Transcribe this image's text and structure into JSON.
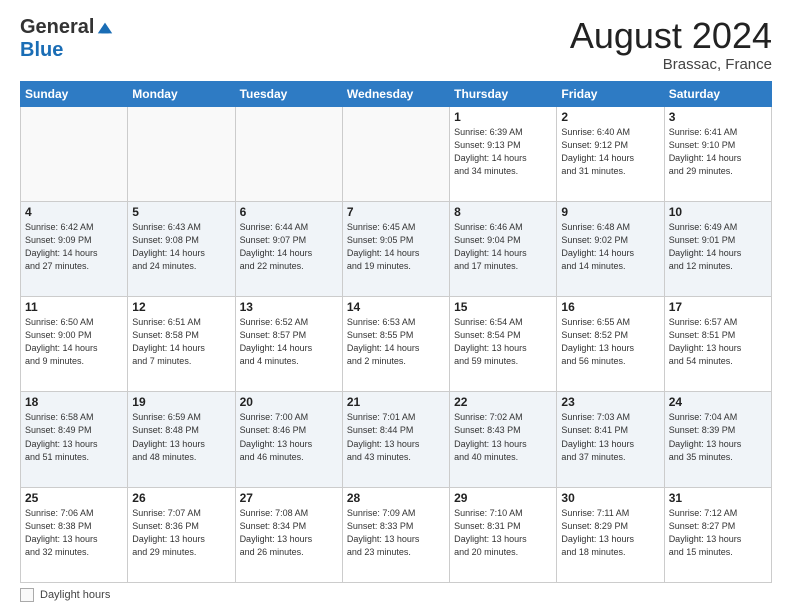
{
  "logo": {
    "general": "General",
    "blue": "Blue"
  },
  "header": {
    "month_year": "August 2024",
    "location": "Brassac, France"
  },
  "days_of_week": [
    "Sunday",
    "Monday",
    "Tuesday",
    "Wednesday",
    "Thursday",
    "Friday",
    "Saturday"
  ],
  "weeks": [
    [
      {
        "day": "",
        "info": ""
      },
      {
        "day": "",
        "info": ""
      },
      {
        "day": "",
        "info": ""
      },
      {
        "day": "",
        "info": ""
      },
      {
        "day": "1",
        "info": "Sunrise: 6:39 AM\nSunset: 9:13 PM\nDaylight: 14 hours\nand 34 minutes."
      },
      {
        "day": "2",
        "info": "Sunrise: 6:40 AM\nSunset: 9:12 PM\nDaylight: 14 hours\nand 31 minutes."
      },
      {
        "day": "3",
        "info": "Sunrise: 6:41 AM\nSunset: 9:10 PM\nDaylight: 14 hours\nand 29 minutes."
      }
    ],
    [
      {
        "day": "4",
        "info": "Sunrise: 6:42 AM\nSunset: 9:09 PM\nDaylight: 14 hours\nand 27 minutes."
      },
      {
        "day": "5",
        "info": "Sunrise: 6:43 AM\nSunset: 9:08 PM\nDaylight: 14 hours\nand 24 minutes."
      },
      {
        "day": "6",
        "info": "Sunrise: 6:44 AM\nSunset: 9:07 PM\nDaylight: 14 hours\nand 22 minutes."
      },
      {
        "day": "7",
        "info": "Sunrise: 6:45 AM\nSunset: 9:05 PM\nDaylight: 14 hours\nand 19 minutes."
      },
      {
        "day": "8",
        "info": "Sunrise: 6:46 AM\nSunset: 9:04 PM\nDaylight: 14 hours\nand 17 minutes."
      },
      {
        "day": "9",
        "info": "Sunrise: 6:48 AM\nSunset: 9:02 PM\nDaylight: 14 hours\nand 14 minutes."
      },
      {
        "day": "10",
        "info": "Sunrise: 6:49 AM\nSunset: 9:01 PM\nDaylight: 14 hours\nand 12 minutes."
      }
    ],
    [
      {
        "day": "11",
        "info": "Sunrise: 6:50 AM\nSunset: 9:00 PM\nDaylight: 14 hours\nand 9 minutes."
      },
      {
        "day": "12",
        "info": "Sunrise: 6:51 AM\nSunset: 8:58 PM\nDaylight: 14 hours\nand 7 minutes."
      },
      {
        "day": "13",
        "info": "Sunrise: 6:52 AM\nSunset: 8:57 PM\nDaylight: 14 hours\nand 4 minutes."
      },
      {
        "day": "14",
        "info": "Sunrise: 6:53 AM\nSunset: 8:55 PM\nDaylight: 14 hours\nand 2 minutes."
      },
      {
        "day": "15",
        "info": "Sunrise: 6:54 AM\nSunset: 8:54 PM\nDaylight: 13 hours\nand 59 minutes."
      },
      {
        "day": "16",
        "info": "Sunrise: 6:55 AM\nSunset: 8:52 PM\nDaylight: 13 hours\nand 56 minutes."
      },
      {
        "day": "17",
        "info": "Sunrise: 6:57 AM\nSunset: 8:51 PM\nDaylight: 13 hours\nand 54 minutes."
      }
    ],
    [
      {
        "day": "18",
        "info": "Sunrise: 6:58 AM\nSunset: 8:49 PM\nDaylight: 13 hours\nand 51 minutes."
      },
      {
        "day": "19",
        "info": "Sunrise: 6:59 AM\nSunset: 8:48 PM\nDaylight: 13 hours\nand 48 minutes."
      },
      {
        "day": "20",
        "info": "Sunrise: 7:00 AM\nSunset: 8:46 PM\nDaylight: 13 hours\nand 46 minutes."
      },
      {
        "day": "21",
        "info": "Sunrise: 7:01 AM\nSunset: 8:44 PM\nDaylight: 13 hours\nand 43 minutes."
      },
      {
        "day": "22",
        "info": "Sunrise: 7:02 AM\nSunset: 8:43 PM\nDaylight: 13 hours\nand 40 minutes."
      },
      {
        "day": "23",
        "info": "Sunrise: 7:03 AM\nSunset: 8:41 PM\nDaylight: 13 hours\nand 37 minutes."
      },
      {
        "day": "24",
        "info": "Sunrise: 7:04 AM\nSunset: 8:39 PM\nDaylight: 13 hours\nand 35 minutes."
      }
    ],
    [
      {
        "day": "25",
        "info": "Sunrise: 7:06 AM\nSunset: 8:38 PM\nDaylight: 13 hours\nand 32 minutes."
      },
      {
        "day": "26",
        "info": "Sunrise: 7:07 AM\nSunset: 8:36 PM\nDaylight: 13 hours\nand 29 minutes."
      },
      {
        "day": "27",
        "info": "Sunrise: 7:08 AM\nSunset: 8:34 PM\nDaylight: 13 hours\nand 26 minutes."
      },
      {
        "day": "28",
        "info": "Sunrise: 7:09 AM\nSunset: 8:33 PM\nDaylight: 13 hours\nand 23 minutes."
      },
      {
        "day": "29",
        "info": "Sunrise: 7:10 AM\nSunset: 8:31 PM\nDaylight: 13 hours\nand 20 minutes."
      },
      {
        "day": "30",
        "info": "Sunrise: 7:11 AM\nSunset: 8:29 PM\nDaylight: 13 hours\nand 18 minutes."
      },
      {
        "day": "31",
        "info": "Sunrise: 7:12 AM\nSunset: 8:27 PM\nDaylight: 13 hours\nand 15 minutes."
      }
    ]
  ],
  "legend": {
    "label": "Daylight hours"
  }
}
